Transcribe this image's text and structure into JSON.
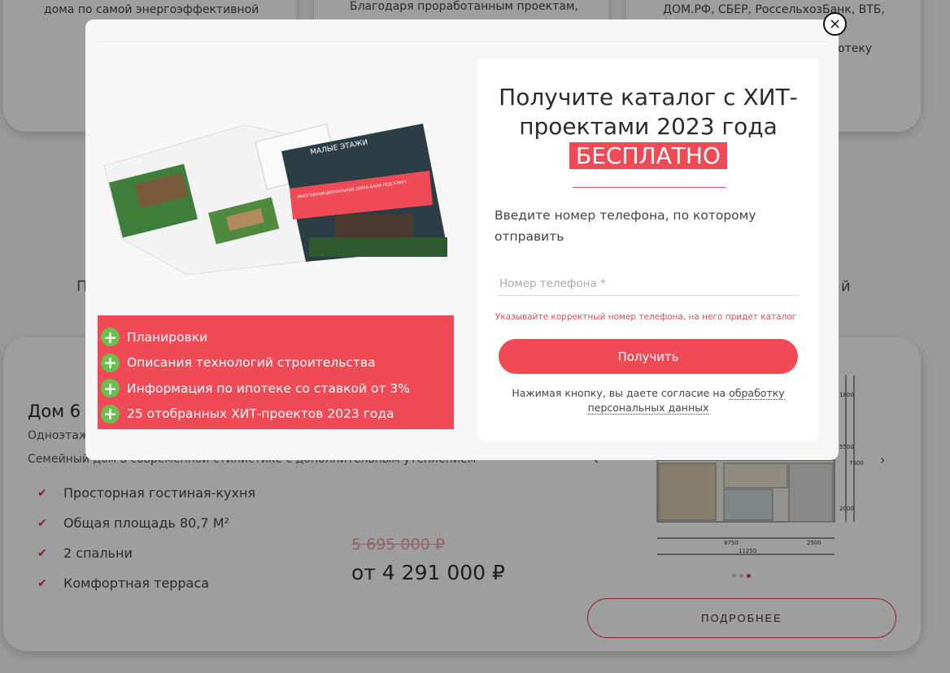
{
  "background": {
    "top_cards": [
      {
        "text": "дома по самой энергоэффективной"
      },
      {
        "text": "Благодаря проработанным проектам,"
      },
      {
        "text": "ДОМ.РФ, СБЕР, РоссельхозБанк, ВТБ,"
      },
      {
        "text": "отеку"
      }
    ],
    "side_letters": {
      "left": "П",
      "right": "й"
    },
    "listing": {
      "title": "Дом 6",
      "subtitle": "Одноэтаж",
      "description": "Семейный дом в современной стилистике с дополнительным утеплением",
      "features": [
        "Просторная гостиная-кухня",
        "Общая площадь 80,7 М²",
        "2 спальни",
        "Комфортная терраса"
      ],
      "old_price": "5 695 000 ₽",
      "price": "от 4 291 000 ₽",
      "details_button": "ПОДРОБНЕЕ",
      "plan_dims": [
        "8750",
        "2500",
        "11250",
        "1800",
        "5500",
        "7500",
        "2000"
      ]
    }
  },
  "modal": {
    "catalog_cover_text": [
      "МАЛЫЕ ЭТАЖИ",
      "МНОГОФУНКЦИОНАЛЬНЫЕ ДОМА-БАНИ ПОД КЛЮЧ"
    ],
    "benefits": [
      "Планировки",
      "Описания технологий строительства",
      "Информация по ипотеке со ставкой от 3%",
      "25 отобранных ХИТ-проектов 2023 года"
    ],
    "title_part1": "Получите каталог с ХИТ-проектами 2023 года",
    "title_highlight": "БЕСПЛАТНО",
    "hint": "Введите номер телефона, по которому отправить",
    "phone_placeholder": "Номер телефона *",
    "phone_value": "",
    "warning": "Указывайте корректный номер телефона, на него придет каталог",
    "submit_label": "Получить",
    "consent_text": "Нажимая кнопку, вы даете согласие на",
    "consent_link": "обработку персональных данных",
    "close_symbol": "×"
  },
  "colors": {
    "accent": "#ef4a55",
    "plus_green": "#69c04f"
  }
}
